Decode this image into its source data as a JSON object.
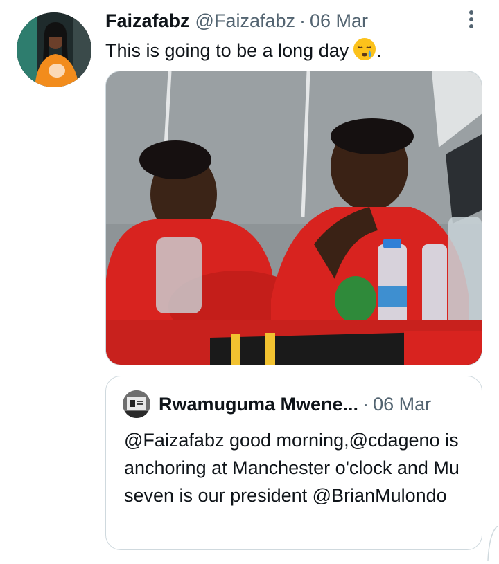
{
  "tweet": {
    "author_name": "Faizafabz",
    "handle": "@Faizafabz",
    "separator": "·",
    "date": "06 Mar",
    "text": "This is going to be a long day",
    "text_end": ".",
    "emoji_icon": "sleepy-face-emoji",
    "more_icon": "vertical-ellipsis-icon"
  },
  "media": {
    "icon": "photo-two-men-at-table",
    "colors": {
      "shirt": "#d8231f",
      "background": "#8e9497"
    }
  },
  "quote": {
    "author_name": "Rwamuguma Mwene...",
    "separator": "·",
    "date": "06 Mar",
    "text": "@Faizafabz good morning,@cdageno is anchoring at Manchester o'clock and Mu seven is our president @BrianMulondo"
  }
}
